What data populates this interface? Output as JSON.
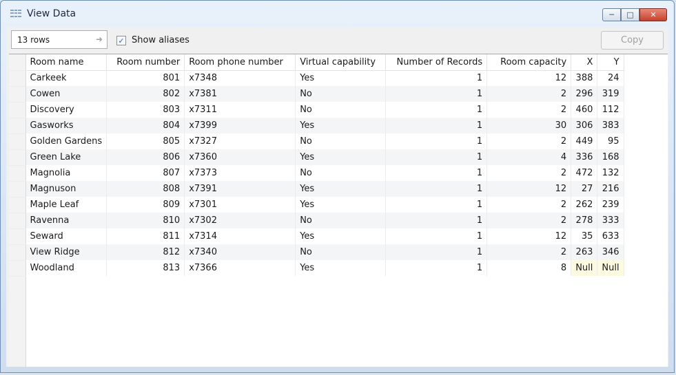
{
  "window": {
    "title": "View Data"
  },
  "toolbar": {
    "rows_label": "13 rows",
    "show_aliases_label": "Show aliases",
    "show_aliases_checked": true,
    "copy_label": "Copy"
  },
  "table": {
    "columns": [
      "Room name",
      "Room number",
      "Room phone number",
      "Virtual capability",
      "Number of Records",
      "Room capacity",
      "X",
      "Y"
    ],
    "rows": [
      [
        "Carkeek",
        "801",
        "x7348",
        "Yes",
        "1",
        "12",
        "388",
        "24"
      ],
      [
        "Cowen",
        "802",
        "x7381",
        "No",
        "1",
        "2",
        "296",
        "319"
      ],
      [
        "Discovery",
        "803",
        "x7311",
        "No",
        "1",
        "2",
        "460",
        "112"
      ],
      [
        "Gasworks",
        "804",
        "x7399",
        "Yes",
        "1",
        "30",
        "306",
        "383"
      ],
      [
        "Golden Gardens",
        "805",
        "x7327",
        "No",
        "1",
        "2",
        "449",
        "95"
      ],
      [
        "Green Lake",
        "806",
        "x7360",
        "Yes",
        "1",
        "4",
        "336",
        "168"
      ],
      [
        "Magnolia",
        "807",
        "x7373",
        "No",
        "1",
        "2",
        "472",
        "132"
      ],
      [
        "Magnuson",
        "808",
        "x7391",
        "Yes",
        "1",
        "12",
        "27",
        "216"
      ],
      [
        "Maple Leaf",
        "809",
        "x7301",
        "Yes",
        "1",
        "2",
        "262",
        "239"
      ],
      [
        "Ravenna",
        "810",
        "x7302",
        "No",
        "1",
        "2",
        "278",
        "333"
      ],
      [
        "Seward",
        "811",
        "x7314",
        "Yes",
        "1",
        "12",
        "35",
        "633"
      ],
      [
        "View Ridge",
        "812",
        "x7340",
        "No",
        "1",
        "2",
        "263",
        "346"
      ],
      [
        "Woodland",
        "813",
        "x7366",
        "Yes",
        "1",
        "8",
        "Null",
        "Null"
      ]
    ]
  }
}
